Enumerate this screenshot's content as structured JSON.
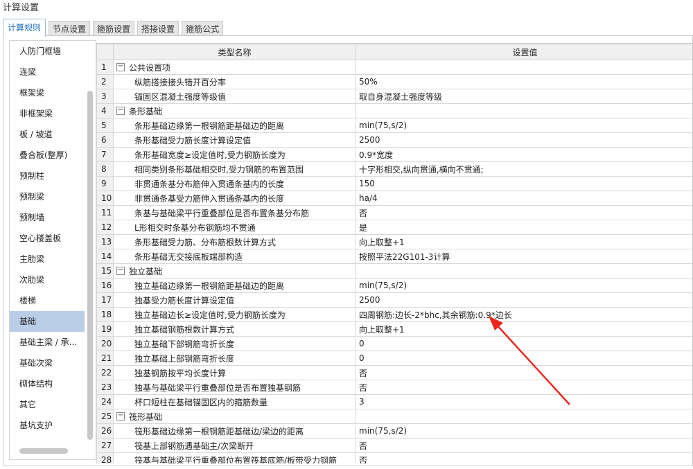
{
  "window": {
    "title": "计算设置"
  },
  "tabs": [
    "计算规则",
    "节点设置",
    "箍筋设置",
    "搭接设置",
    "箍筋公式"
  ],
  "active_tab": 0,
  "sidebar": {
    "items": [
      "人防门框墙",
      "连梁",
      "框架梁",
      "非框架梁",
      "板 / 坡道",
      "叠合板(整厚)",
      "预制柱",
      "预制梁",
      "预制墙",
      "空心楼盖板",
      "主肋梁",
      "次肋梁",
      "楼梯",
      "基础",
      "基础主梁 / 承...",
      "基础次梁",
      "砌体结构",
      "其它",
      "基坑支护"
    ],
    "active_index": 13
  },
  "table": {
    "headers": {
      "name": "类型名称",
      "value": "设置值"
    },
    "rows": [
      {
        "num": "1",
        "name": "公共设置项",
        "value": "",
        "group": true,
        "toggle": "−"
      },
      {
        "num": "2",
        "name": "纵筋搭接接头错开百分率",
        "value": "50%"
      },
      {
        "num": "3",
        "name": "锚固区混凝土强度等级值",
        "value": "取自身混凝土强度等级"
      },
      {
        "num": "4",
        "name": "条形基础",
        "value": "",
        "group": true,
        "toggle": "−"
      },
      {
        "num": "5",
        "name": "条形基础边缘第一根钢筋距基础边的距离",
        "value": "min(75,s/2)"
      },
      {
        "num": "6",
        "name": "条形基础受力筋长度计算设定值",
        "value": "2500"
      },
      {
        "num": "7",
        "name": "条形基础宽度≥设定值时,受力钢筋长度为",
        "value": "0.9*宽度"
      },
      {
        "num": "8",
        "name": "相同类别条形基础相交时,受力钢筋的布置范围",
        "value": "十字形相交,纵向贯通,横向不贯通;"
      },
      {
        "num": "9",
        "name": "非贯通条基分布筋伸入贯通条基内的长度",
        "value": "150"
      },
      {
        "num": "10",
        "name": "非贯通条基受力筋伸入贯通条基内的长度",
        "value": "ha/4"
      },
      {
        "num": "11",
        "name": "条基与基础梁平行重叠部位是否布置条基分布筋",
        "value": "否"
      },
      {
        "num": "12",
        "name": "L形相交时条基分布钢筋均不贯通",
        "value": "是"
      },
      {
        "num": "13",
        "name": "条形基础受力筋、分布筋根数计算方式",
        "value": "向上取整+1"
      },
      {
        "num": "14",
        "name": "条形基础无交接底板端部构造",
        "value": "按照平法22G101-3计算"
      },
      {
        "num": "15",
        "name": "独立基础",
        "value": "",
        "group": true,
        "toggle": "−"
      },
      {
        "num": "16",
        "name": "独立基础边缘第一根钢筋距基础边的距离",
        "value": "min(75,s/2)"
      },
      {
        "num": "17",
        "name": "独基受力筋长度计算设定值",
        "value": "2500"
      },
      {
        "num": "18",
        "name": "独立基础边长≥设定值时,受力钢筋长度为",
        "value": "四周钢筋:边长-2*bhc,其余钢筋:0.9*边长"
      },
      {
        "num": "19",
        "name": "独立基础钢筋根数计算方式",
        "value": "向上取整+1"
      },
      {
        "num": "20",
        "name": "独立基础下部钢筋弯折长度",
        "value": "0"
      },
      {
        "num": "21",
        "name": "独立基础上部钢筋弯折长度",
        "value": "0"
      },
      {
        "num": "22",
        "name": "独基钢筋按平均长度计算",
        "value": "否"
      },
      {
        "num": "23",
        "name": "独基与基础梁平行重叠部位是否布置独基钢筋",
        "value": "否"
      },
      {
        "num": "24",
        "name": "杯口短柱在基础锚固区内的箍筋数量",
        "value": "3"
      },
      {
        "num": "25",
        "name": "筏形基础",
        "value": "",
        "group": true,
        "toggle": "−"
      },
      {
        "num": "26",
        "name": "筏形基础边缘第一根钢筋距基础边/梁边的距离",
        "value": "min(75,s/2)"
      },
      {
        "num": "27",
        "name": "筏基上部钢筋遇基础主/次梁断开",
        "value": "否"
      },
      {
        "num": "28",
        "name": "筏基与基础梁平行重叠部位布置筏基底筋/板带受力钢筋",
        "value": "否"
      }
    ]
  },
  "annotation": {
    "color": "#e8281e"
  },
  "colors": {
    "accent": "#1f6fbf",
    "selected": "#b9cde6"
  }
}
